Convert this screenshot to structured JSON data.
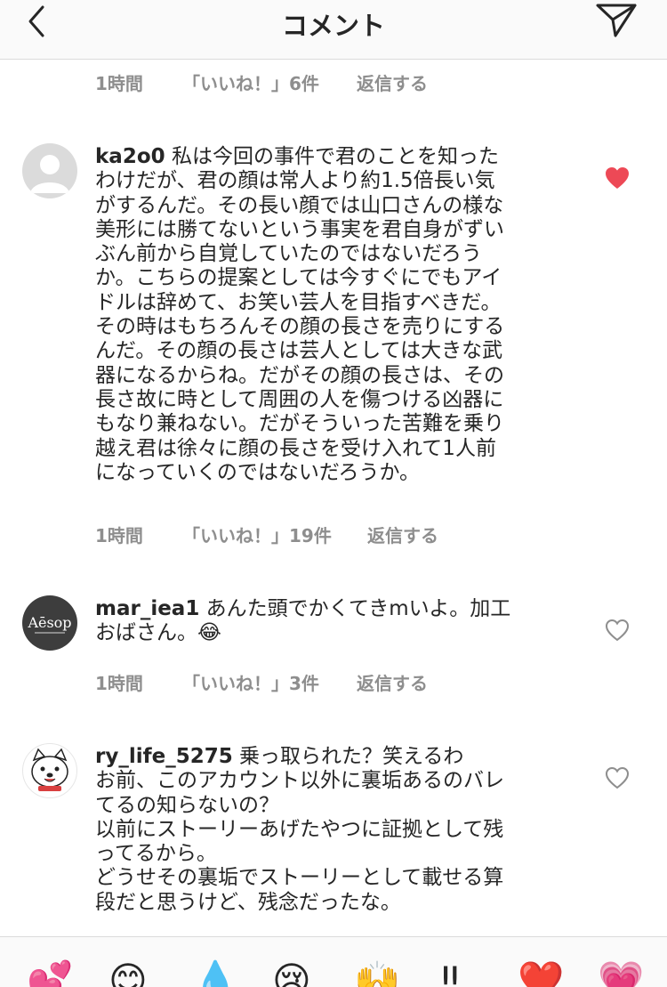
{
  "header": {
    "title": "コメント"
  },
  "top_meta": {
    "time": "1時間",
    "likes": "「いいね！」6件",
    "reply": "返信する"
  },
  "comments": [
    {
      "username": "ka2o0",
      "lines": [
        "私は今回の事件で君のことを知った",
        "わけだが、君の顔は常人より約1.5倍長い気",
        "がするんだ。その長い顔では山口さんの様な",
        "美形には勝てないという事実を君自身がずい",
        "ぶん前から自覚していたのではないだろう",
        "か。こちらの提案としては今すぐにでもアイ",
        "ドルは辞めて、お笑い芸人を目指すべきだ。",
        "その時はもちろんその顔の長さを売りにする",
        "んだ。その顔の長さは芸人としては大きな武",
        "器になるからね。だがその顔の長さは、その",
        "長さ故に時として周囲の人を傷つける凶器に",
        "もなり兼ねない。だがそういった苦難を乗り",
        "越え君は徐々に顔の長さを受け入れて1人前",
        "になっていくのではないだろうか。"
      ],
      "time": "1時間",
      "likes": "「いいね！」19件",
      "reply": "返信する",
      "liked": true
    },
    {
      "username": "mar_iea1",
      "avatar_text": "Aēsop",
      "lines": [
        "あんた頭でかくてきmいよ。加工",
        "おばさん。😂"
      ],
      "time": "1時間",
      "likes": "「いいね！」3件",
      "reply": "返信する",
      "liked": false
    },
    {
      "username": "ry_life_5275",
      "lines": [
        "乗っ取られた？笑えるわ",
        "お前、このアカウント以外に裏垢あるのバレ",
        "てるの知らないの？",
        "以前にストーリーあげたやつに証拠として残",
        "ってるから。",
        "どうせその裏垢でストーリーとして載せる算",
        "段だと思うけど、残念だったな。"
      ],
      "liked": false
    }
  ],
  "emoji_bar": [
    "💕",
    "😊",
    "💧",
    "😢",
    "🙌",
    "‼",
    "❤️",
    "💗"
  ],
  "colors": {
    "liked_heart": "#ed4956",
    "meta_text": "#8e8e8e",
    "text": "#262626"
  }
}
